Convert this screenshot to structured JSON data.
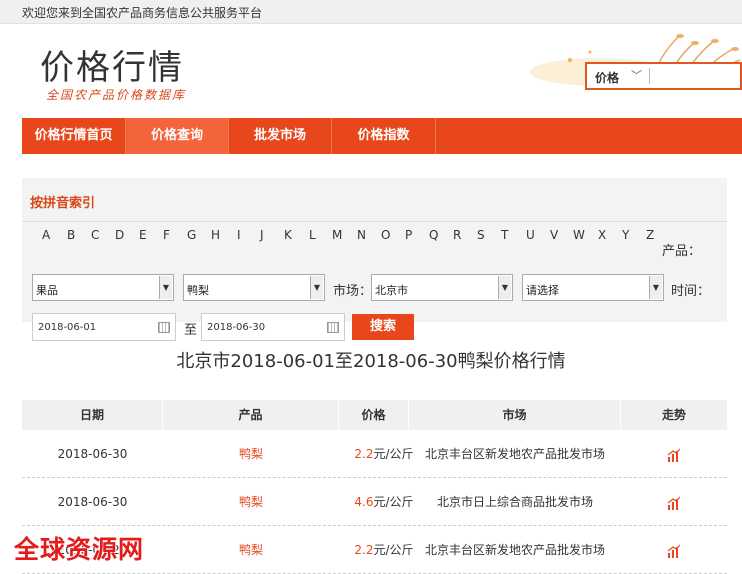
{
  "topbar": {
    "welcome": "欢迎您来到全国农产品商务信息公共服务平台"
  },
  "logo": {
    "title": "价格行情",
    "subtitle": "全国农产品价格数据库"
  },
  "search": {
    "type": "价格",
    "placeholder": ""
  },
  "nav": [
    {
      "label": "价格行情首页"
    },
    {
      "label": "价格查询"
    },
    {
      "label": "批发市场"
    },
    {
      "label": "价格指数"
    }
  ],
  "filter": {
    "title": "按拼音索引",
    "letters": [
      "A",
      "B",
      "C",
      "D",
      "E",
      "F",
      "G",
      "H",
      "I",
      "J",
      "K",
      "L",
      "M",
      "N",
      "O",
      "P",
      "Q",
      "R",
      "S",
      "T",
      "U",
      "V",
      "W",
      "X",
      "Y",
      "Z"
    ],
    "product_label": "产品：",
    "category": "果品",
    "product": "鸭梨",
    "market_label": "市场：",
    "market": "北京市",
    "market_sub": "请选择",
    "time_label": "时间：",
    "date_from": "2018-06-01",
    "to_label": "至",
    "date_to": "2018-06-30",
    "search_label": "搜索"
  },
  "result_title": "北京市2018-06-01至2018-06-30鸭梨价格行情",
  "table": {
    "headers": [
      "日期",
      "产品",
      "价格",
      "市场",
      "走势"
    ],
    "rows": [
      {
        "date": "2018-06-30",
        "product": "鸭梨",
        "price": "2.2",
        "unit": "元/公斤",
        "market": "北京丰台区新发地农产品批发市场"
      },
      {
        "date": "2018-06-30",
        "product": "鸭梨",
        "price": "4.6",
        "unit": "元/公斤",
        "market": "北京市日上综合商品批发市场"
      },
      {
        "date": "2018-06-29",
        "product": "鸭梨",
        "price": "2.2",
        "unit": "元/公斤",
        "market": "北京丰台区新发地农产品批发市场"
      }
    ]
  },
  "watermark": "全球资源网",
  "colors": {
    "accent": "#e8471c",
    "nav_active": "#f3643a"
  }
}
